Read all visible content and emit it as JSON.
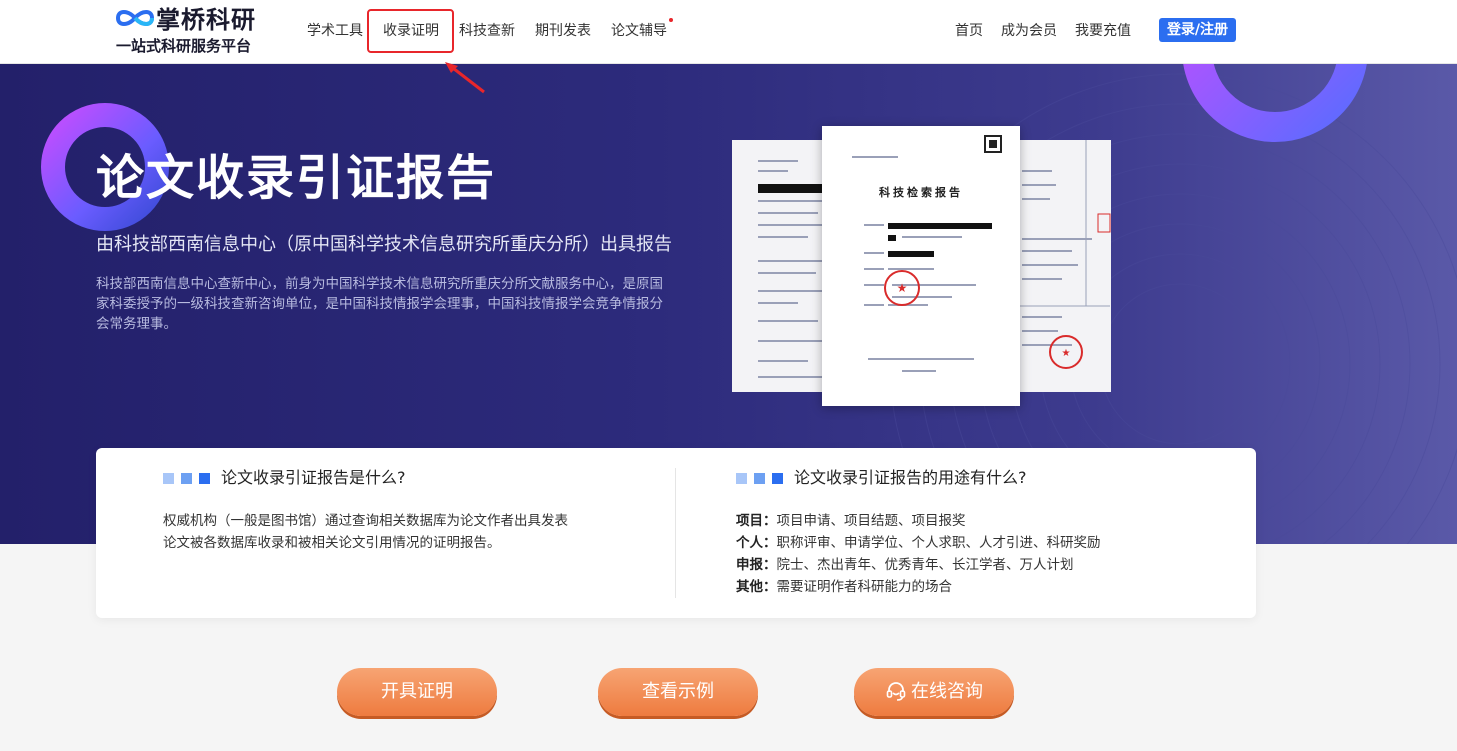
{
  "header": {
    "logo_name": "掌桥科研",
    "logo_sub": "一站式科研服务平台",
    "nav": [
      {
        "label": "学术工具"
      },
      {
        "label": "收录证明"
      },
      {
        "label": "科技查新"
      },
      {
        "label": "期刊发表"
      },
      {
        "label": "论文辅导"
      }
    ],
    "right_nav": [
      {
        "label": "首页"
      },
      {
        "label": "成为会员"
      },
      {
        "label": "我要充值"
      }
    ],
    "login_label": "登录/注册"
  },
  "banner": {
    "title": "论文收录引证报告",
    "subtitle": "由科技部西南信息中心（原中国科学技术信息研究所重庆分所）出具报告",
    "description": "科技部西南信息中心查新中心，前身为中国科学技术信息研究所重庆分所文献服务中心，是原国家科委授予的一级科技查新咨询单位，是中国科技情报学会理事，中国科技情报学会竞争情报分会常务理事。",
    "doc_title": "科技检索报告"
  },
  "info": {
    "what": {
      "title": "论文收录引证报告是什么?",
      "lines": [
        "权威机构（一般是图书馆）通过查询相关数据库为论文作者出具发表",
        "论文被各数据库收录和被相关论文引用情况的证明报告。"
      ]
    },
    "uses": {
      "title": "论文收录引证报告的用途有什么?",
      "items": [
        {
          "label": "项目：",
          "text": "项目申请、项目结题、项目报奖"
        },
        {
          "label": "个人：",
          "text": "职称评审、申请学位、个人求职、人才引进、科研奖励"
        },
        {
          "label": "申报：",
          "text": "院士、杰出青年、优秀青年、长江学者、万人计划"
        },
        {
          "label": "其他：",
          "text": "需要证明作者科研能力的场合"
        }
      ]
    }
  },
  "actions": {
    "issue": "开具证明",
    "example": "查看示例",
    "consult": "在线咨询"
  }
}
